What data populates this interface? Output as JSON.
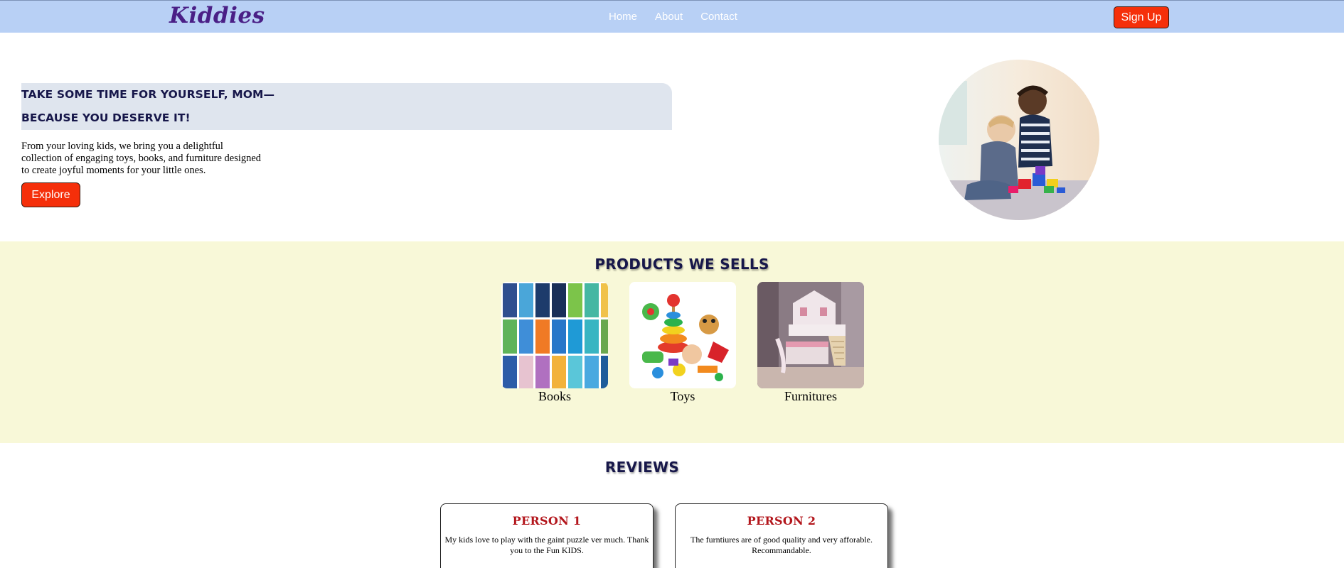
{
  "nav": {
    "logo": "Kiddies",
    "links": [
      "Home",
      "About",
      "Contact"
    ],
    "signup_label": "Sign Up"
  },
  "hero": {
    "heading_line1": "TAKE SOME TIME FOR YOURSELF, MOM—",
    "heading_line2": "BECAUSE YOU DESERVE IT!",
    "text": "From your loving kids, we bring you a delightful collection of engaging toys, books, and furniture designed to create joyful moments for your little ones.",
    "explore_label": "Explore"
  },
  "products": {
    "title": "PRODUCTS WE SELLS",
    "items": [
      {
        "label": "Books"
      },
      {
        "label": "Toys"
      },
      {
        "label": "Furnitures"
      }
    ]
  },
  "reviews": {
    "title": "REVIEWS",
    "items": [
      {
        "name": "PERSON 1",
        "text": "My kids love to play with the gaint puzzle ver much. Thank you to the Fun KIDS."
      },
      {
        "name": "PERSON 2",
        "text": "The furntiures are of good quality and very afforable. Recommandable."
      }
    ]
  },
  "colors": {
    "navbar_bg": "#b8d0f5",
    "accent_button": "#f52f0a",
    "logo": "#4a1f86",
    "heading": "#17174a",
    "hero_band": "#dfe5ee",
    "products_bg": "#f8f8d8",
    "review_name": "#b3161c"
  }
}
